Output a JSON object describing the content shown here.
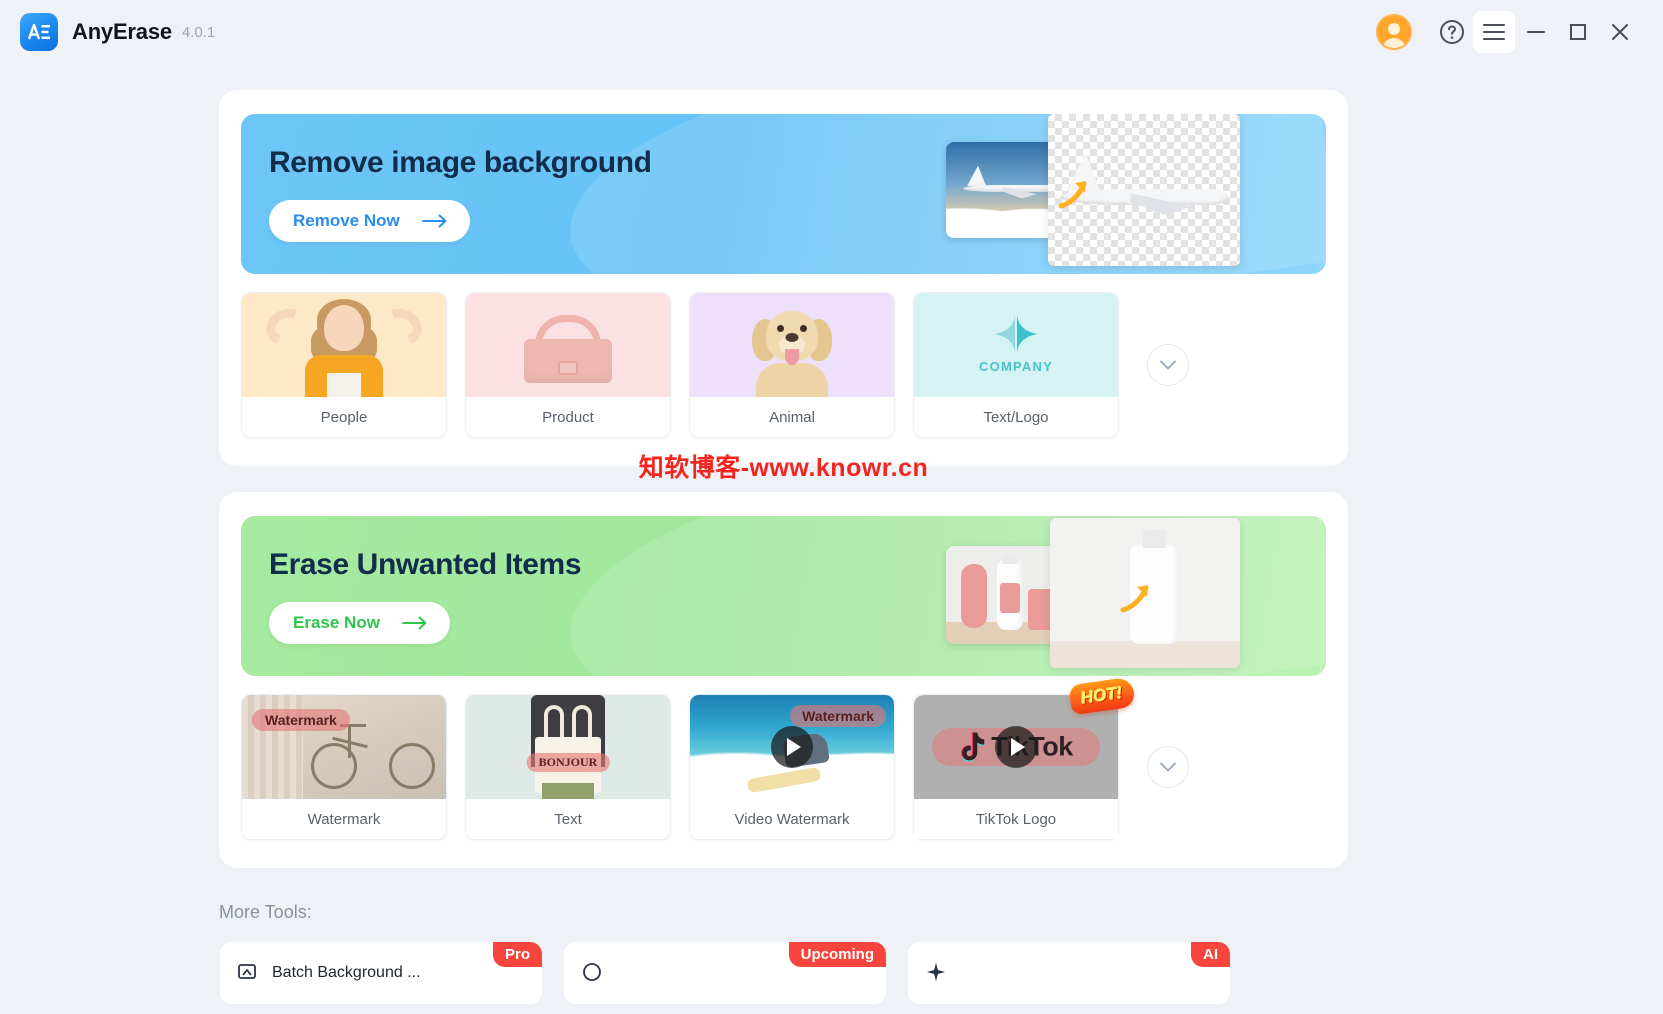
{
  "titlebar": {
    "app_name": "AnyErase",
    "version": "4.0.1",
    "logo_text": "AE",
    "controls": {
      "avatar": "user-avatar",
      "help": "?",
      "menu": "hamburger-menu",
      "minimize": "minimize",
      "maximize": "maximize",
      "close": "close"
    }
  },
  "watermark": {
    "text": "知软博客-www.knowr.cn",
    "color": "#f4241f"
  },
  "sections": [
    {
      "id": "remove-background",
      "accent": "#66c3f6",
      "banner": {
        "title": "Remove image background",
        "button_label": "Remove Now",
        "button_text_color": "#2a8cf0"
      },
      "cards": [
        {
          "label": "People",
          "thumb_class": "bg-peach"
        },
        {
          "label": "Product",
          "thumb_class": "bg-pink"
        },
        {
          "label": "Animal",
          "thumb_class": "bg-lilac"
        },
        {
          "label": "Text/Logo",
          "thumb_class": "bg-mint",
          "overlay_text": "COMPANY"
        }
      ],
      "expand_icon": "chevron-down-icon"
    },
    {
      "id": "erase-items",
      "accent": "#a0e79c",
      "banner": {
        "title": "Erase Unwanted Items",
        "button_label": "Erase Now",
        "button_text_color": "#2fc44a"
      },
      "cards": [
        {
          "label": "Watermark",
          "thumb_class": "bike",
          "overlay_text": "Watermark"
        },
        {
          "label": "Text",
          "thumb_class": "bg-sage",
          "overlay_text": "BONJOUR"
        },
        {
          "label": "Video Watermark",
          "thumb_class": "surf",
          "overlay_text": "Watermark",
          "has_play": true
        },
        {
          "label": "TikTok Logo",
          "thumb_class": "bg-gray",
          "overlay_text": "TikTok",
          "has_play": true,
          "badge": "HOT!"
        }
      ],
      "expand_icon": "chevron-down-icon"
    }
  ],
  "more_tools": {
    "label": "More Tools:",
    "items": [
      {
        "name": "Batch Background ...",
        "badge": "Pro",
        "badge_color": "#f5453c"
      },
      {
        "name": "",
        "badge": "Upcoming",
        "badge_color": "#f5453c"
      },
      {
        "name": "",
        "badge": "AI",
        "badge_color": "#f5453c"
      }
    ]
  }
}
